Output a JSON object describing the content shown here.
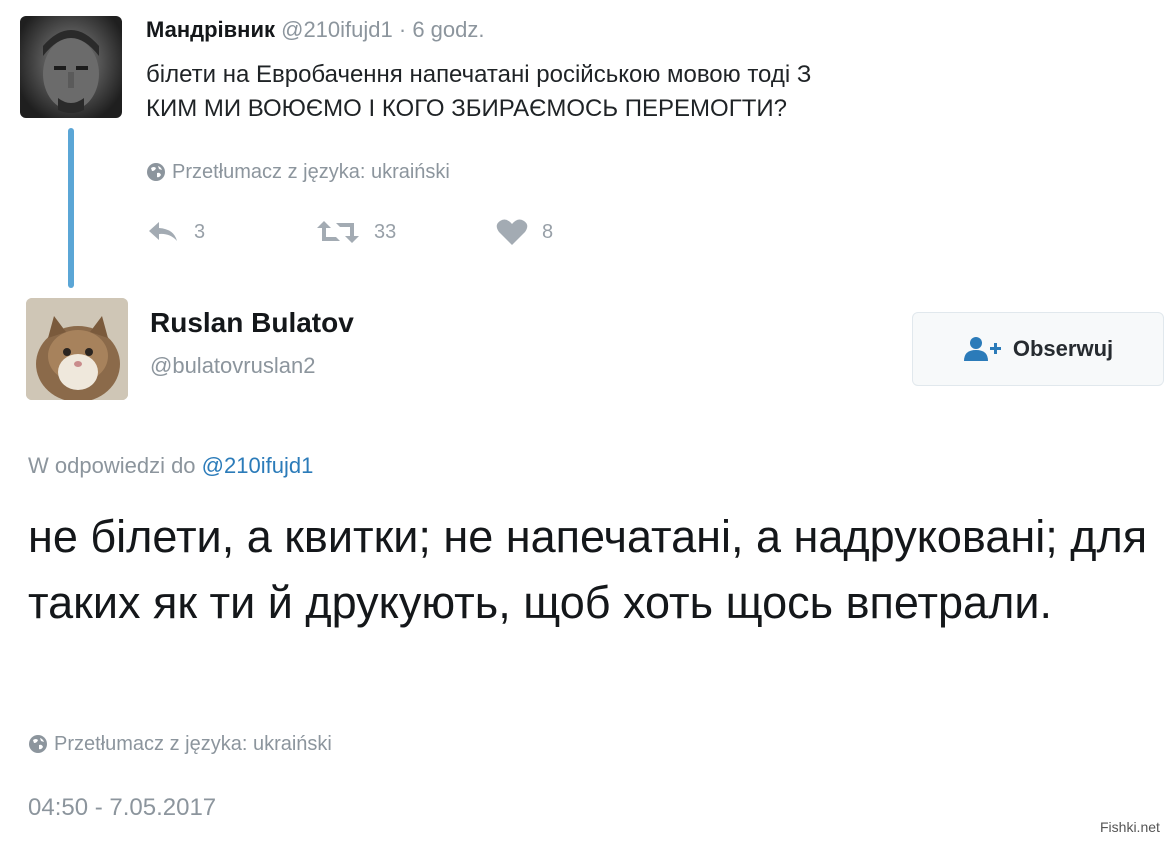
{
  "parent_tweet": {
    "author_name": "Мандрівник",
    "handle": "@210ifujd1",
    "time": "6 godz.",
    "separator": "·",
    "text": "білети на Евробачення напечатані російською мовою тоді З КИМ МИ ВОЮЄМО І КОГО ЗБИРАЄМОСЬ ПЕРЕМОГТИ?",
    "translate_label": "Przetłumacz z języka: ukraiński",
    "replies": "3",
    "retweets": "33",
    "likes": "8"
  },
  "reply_tweet": {
    "author_name": "Ruslan Bulatov",
    "handle": "@bulatovruslan2",
    "follow_label": "Obserwuj",
    "reply_prefix": "W odpowiedzi do",
    "reply_mention": "@210ifujd1",
    "text": "не білети, а квитки; не напечатані, а надруковані; для таких як ти й друкують, щоб хоть щось впетрали.",
    "translate_label": "Przetłumacz z języka: ukraiński",
    "timestamp": "04:50 - 7.05.2017"
  },
  "watermark": "Fishki.net",
  "icons": {
    "globe": "globe-icon",
    "reply": "reply-icon",
    "retweet": "retweet-icon",
    "like": "heart-icon",
    "follow": "add-user-icon"
  },
  "colors": {
    "thread_line": "#5ba6d6",
    "mention": "#2b7bb9",
    "muted": "#8c959d"
  }
}
